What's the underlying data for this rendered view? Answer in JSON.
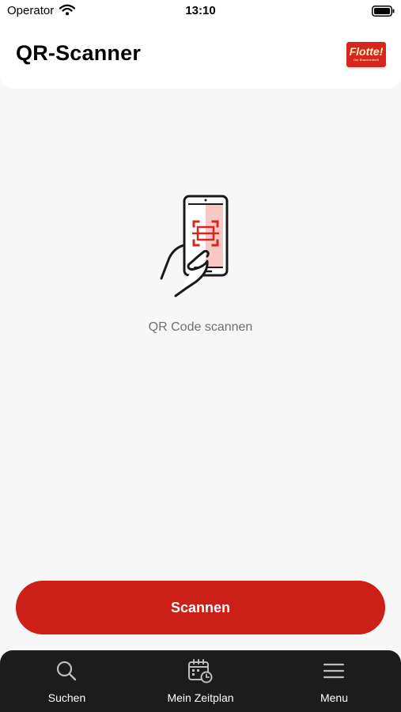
{
  "status_bar": {
    "carrier": "Operator",
    "time": "13:10"
  },
  "header": {
    "title": "QR-Scanner",
    "logo": {
      "wordmark": "Flotte!",
      "tagline": "Der Branchentreff"
    }
  },
  "main": {
    "illustration_icon": "hand-phone-qr-icon",
    "hint": "QR Code scannen",
    "scan_button_label": "Scannen"
  },
  "tab_bar": {
    "items": [
      {
        "label": "Suchen",
        "icon": "search-icon"
      },
      {
        "label": "Mein Zeitplan",
        "icon": "calendar-clock-icon"
      },
      {
        "label": "Menu",
        "icon": "menu-icon"
      }
    ]
  },
  "colors": {
    "accent": "#cc1f18",
    "tab_bar": "#1c1c1c",
    "background": "#f7f7f7",
    "hint_text": "#6f6f6f"
  }
}
